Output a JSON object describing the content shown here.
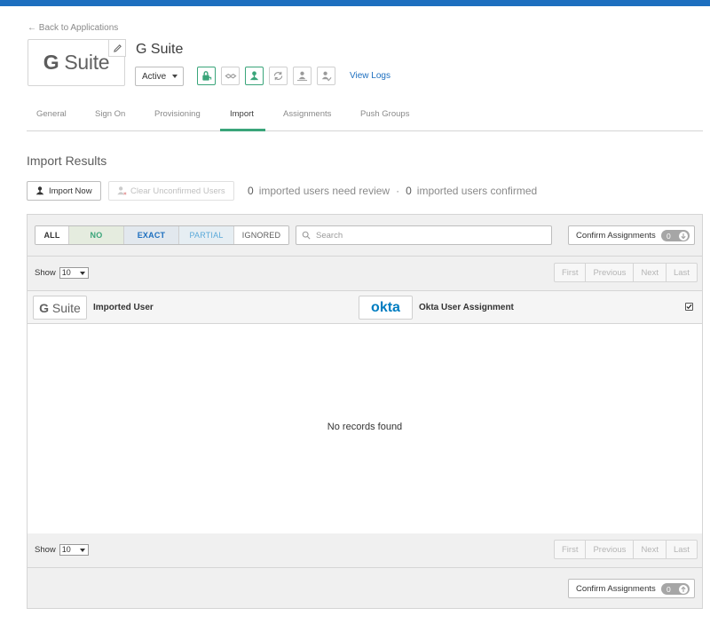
{
  "nav": {
    "back_label": "← Back to Applications"
  },
  "app": {
    "logo_text_bold": "G",
    "logo_text_rest": " Suite",
    "title": "G Suite",
    "status": "Active",
    "view_logs": "View Logs"
  },
  "header_icons": [
    "lock-icon",
    "handshake-icon",
    "user-assign-icon",
    "sync-icon",
    "user-push-icon",
    "user-check-icon"
  ],
  "tabs": [
    "General",
    "Sign On",
    "Provisioning",
    "Import",
    "Assignments",
    "Push Groups"
  ],
  "active_tab": "Import",
  "section_title": "Import Results",
  "actions": {
    "import_now": "Import Now",
    "clear_unconfirmed": "Clear Unconfirmed Users"
  },
  "stats": {
    "review_count": "0",
    "review_label": "imported users need review",
    "separator": "·",
    "confirmed_count": "0",
    "confirmed_label": "imported users confirmed"
  },
  "filters": [
    "ALL",
    "NO",
    "EXACT",
    "PARTIAL",
    "IGNORED"
  ],
  "search": {
    "placeholder": "Search"
  },
  "confirm": {
    "label": "Confirm Assignments",
    "count": "0"
  },
  "paging": {
    "show_label": "Show",
    "page_size": "10",
    "buttons": [
      "First",
      "Previous",
      "Next",
      "Last"
    ]
  },
  "columns": {
    "imported_user": "Imported User",
    "okta_logo": "okta",
    "okta_user_assignment": "Okta User Assignment",
    "gsuite_logo_bold": "G",
    "gsuite_logo_rest": " Suite"
  },
  "empty_message": "No records found",
  "colors": {
    "accent_green": "#3aa57a",
    "link_blue": "#1d6fbf",
    "okta_blue": "#007dc1"
  }
}
